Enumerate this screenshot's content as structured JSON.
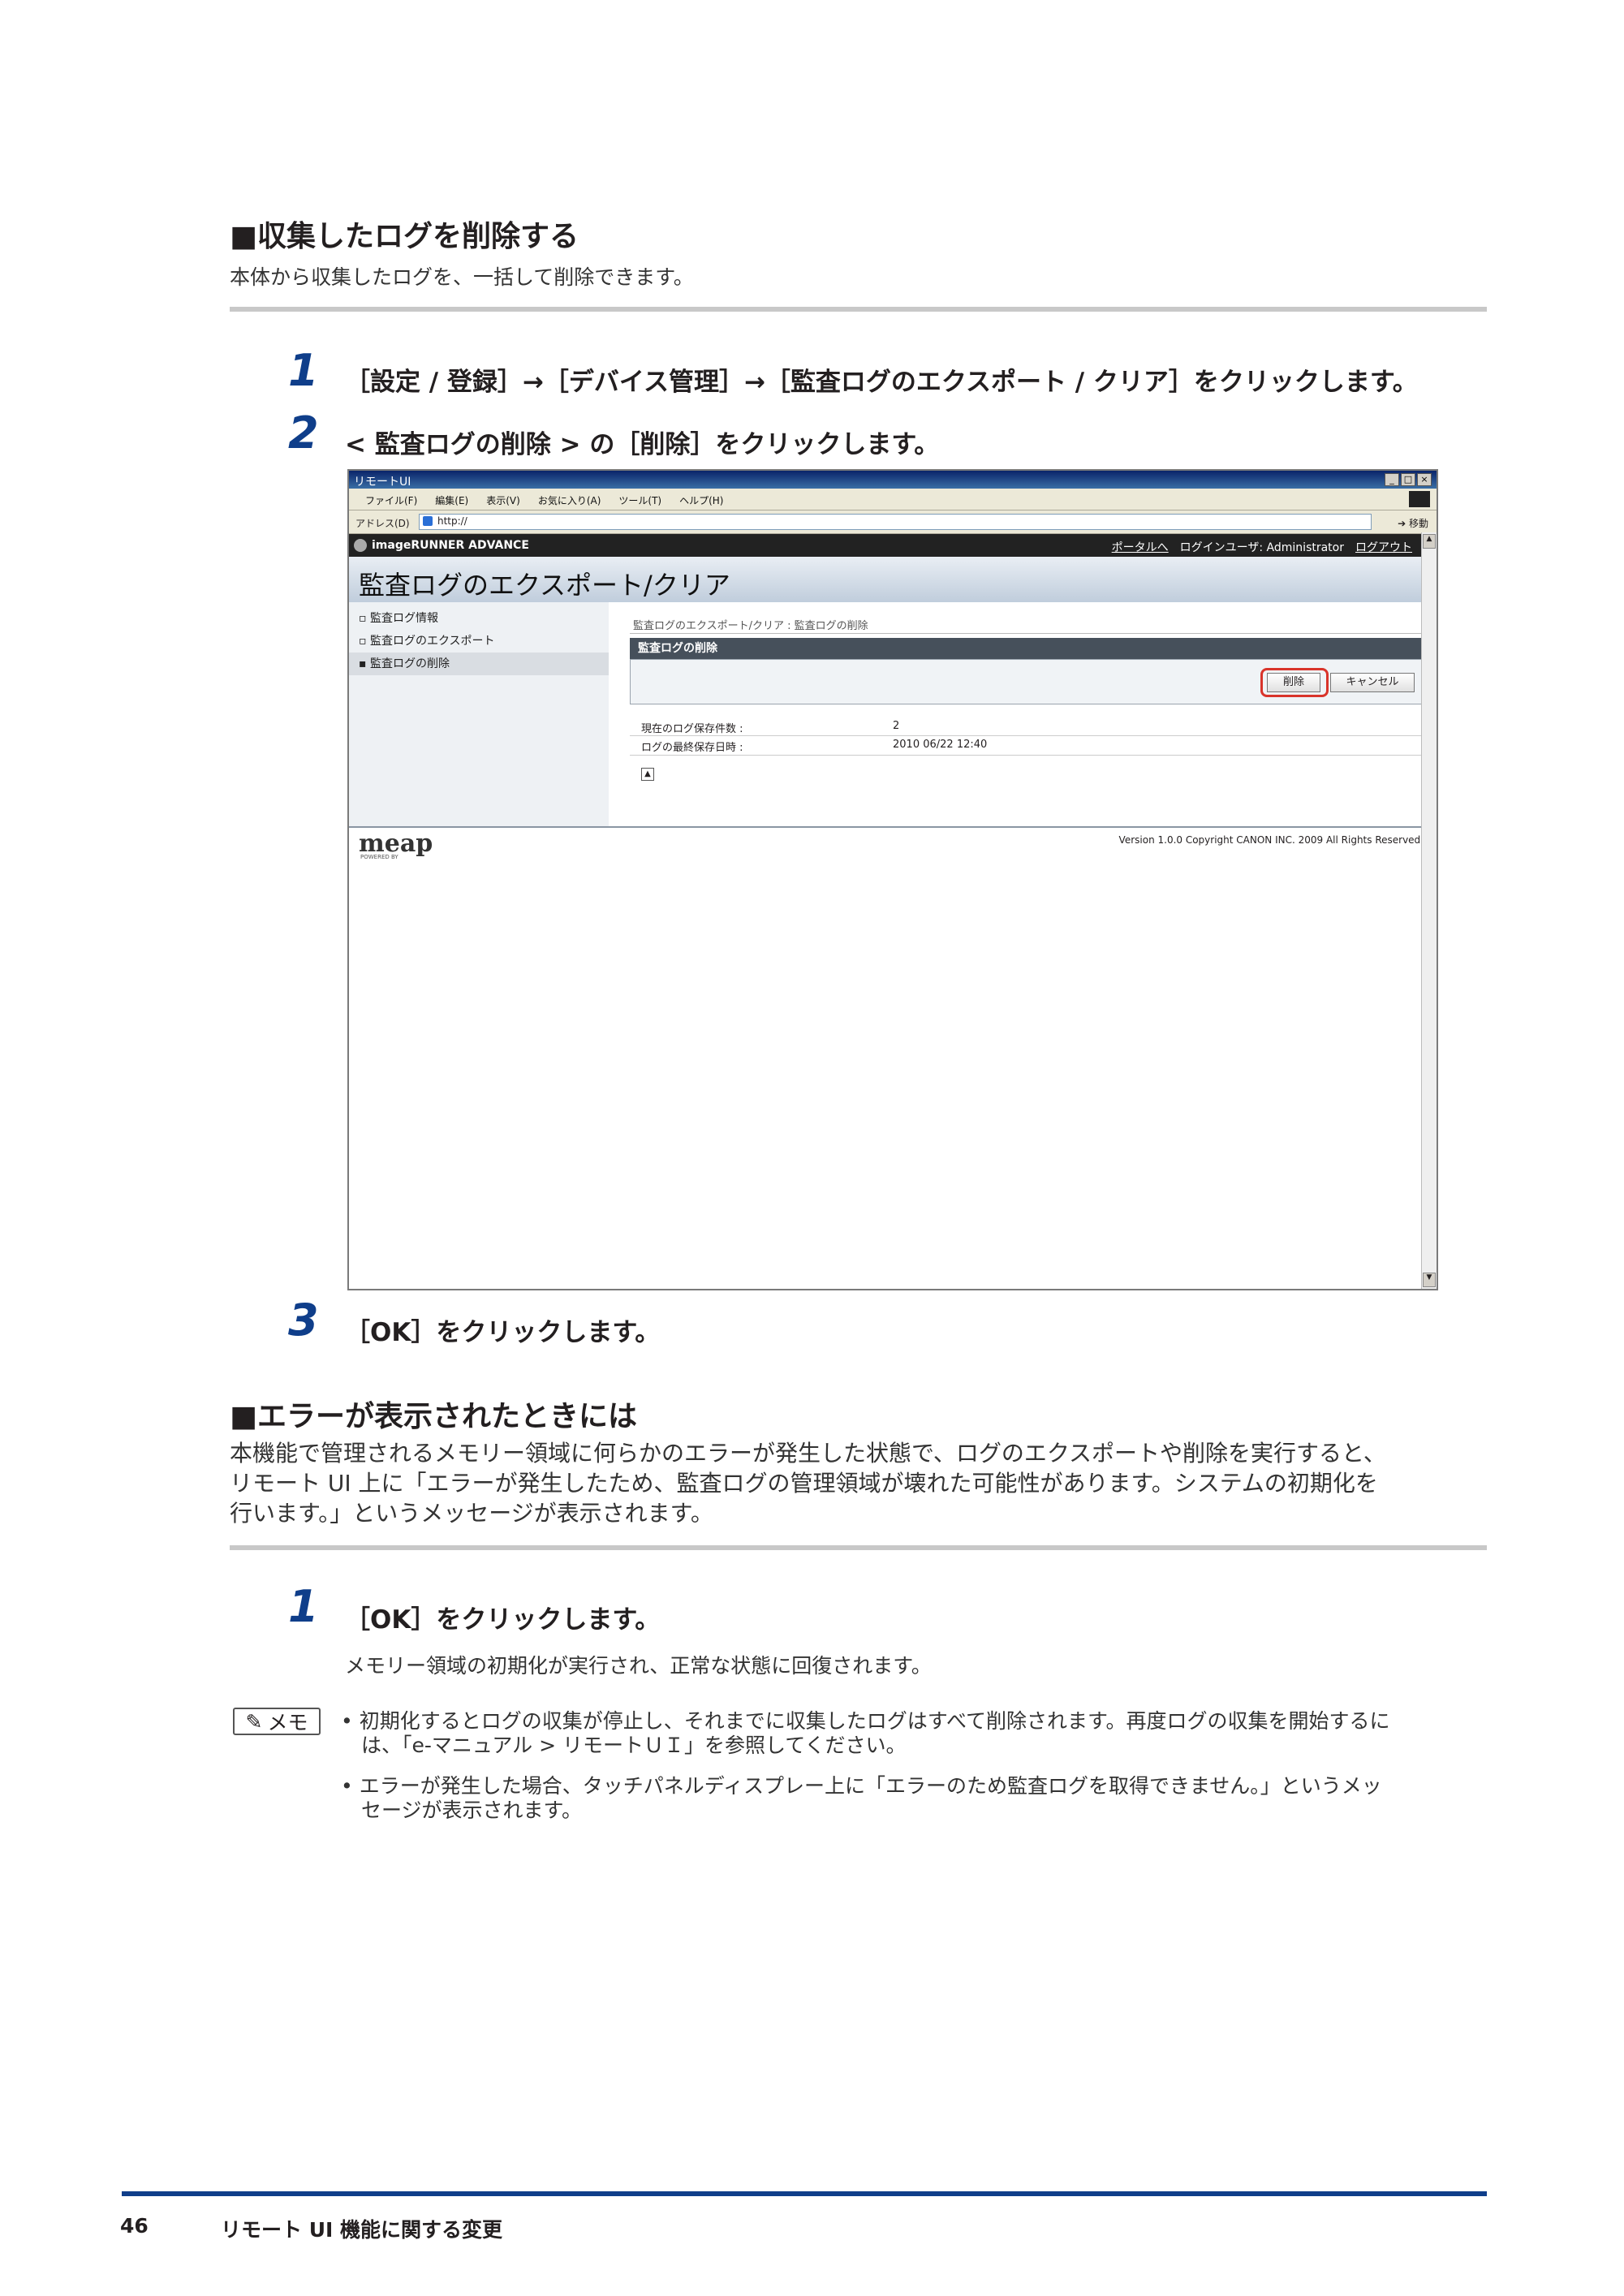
{
  "section1": {
    "title": "■収集したログを削除する",
    "subtitle": "本体から収集したログを、一括して削除できます。"
  },
  "steps1": [
    {
      "num": "1",
      "text": "［設定 / 登録］→［デバイス管理］→［監査ログのエクスポート / クリア］をクリックします。"
    },
    {
      "num": "2",
      "text": "< 監査ログの削除 > の［削除］をクリックします。"
    },
    {
      "num": "3",
      "text": "［OK］をクリックします。"
    }
  ],
  "screenshot": {
    "window_title": "リモートUI",
    "menu": [
      "ファイル(F)",
      "編集(E)",
      "表示(V)",
      "お気に入り(A)",
      "ツール(T)",
      "ヘルプ(H)"
    ],
    "address_label": "アドレス(D)",
    "address_value": "http://",
    "go_label": "移動",
    "brand": "imageRUNNER ADVANCE",
    "portal_link": "ポータルへ",
    "login_user": "ログインユーザ: Administrator",
    "logout_link": "ログアウト",
    "page_title": "監査ログのエクスポート/クリア",
    "nav": [
      "監査ログ情報",
      "監査ログのエクスポート",
      "監査ログの削除"
    ],
    "breadcrumb": "監査ログのエクスポート/クリア : 監査ログの削除",
    "panel_title": "監査ログの削除",
    "delete_button": "削除",
    "cancel_button": "キャンセル",
    "info": [
      {
        "label": "現在のログ保存件数 :",
        "value": "2"
      },
      {
        "label": "ログの最終保存日時 :",
        "value": "2010 06/22 12:40"
      }
    ],
    "meap_logo": "meap",
    "meap_sub": "POWERED BY",
    "copyright": "Version 1.0.0 Copyright CANON INC. 2009 All Rights Reserved."
  },
  "section2": {
    "title": "■エラーが表示されたときには",
    "desc": [
      "本機能で管理されるメモリー領域に何らかのエラーが発生した状態で、ログのエクスポートや削除を実行すると、",
      "リモート UI 上に「エラーが発生したため、監査ログの管理領域が壊れた可能性があります。システムの初期化を",
      "行います。」というメッセージが表示されます。"
    ]
  },
  "steps2": [
    {
      "num": "1",
      "text": "［OK］をクリックします。",
      "sub": "メモリー領域の初期化が実行され、正常な状態に回復されます。"
    }
  ],
  "memo": {
    "label": "メモ",
    "items": [
      [
        "• 初期化するとログの収集が停止し、それまでに収集したログはすべて削除されます。再度ログの収集を開始するに",
        "　は、「e-マニュアル > リモートＵＩ」を参照してください。"
      ],
      [
        "• エラーが発生した場合、タッチパネルディスプレー上に「エラーのため監査ログを取得できません。」というメッ",
        "　セージが表示されます。"
      ]
    ]
  },
  "footer": {
    "page_number": "46",
    "chapter": "リモート UI 機能に関する変更"
  }
}
